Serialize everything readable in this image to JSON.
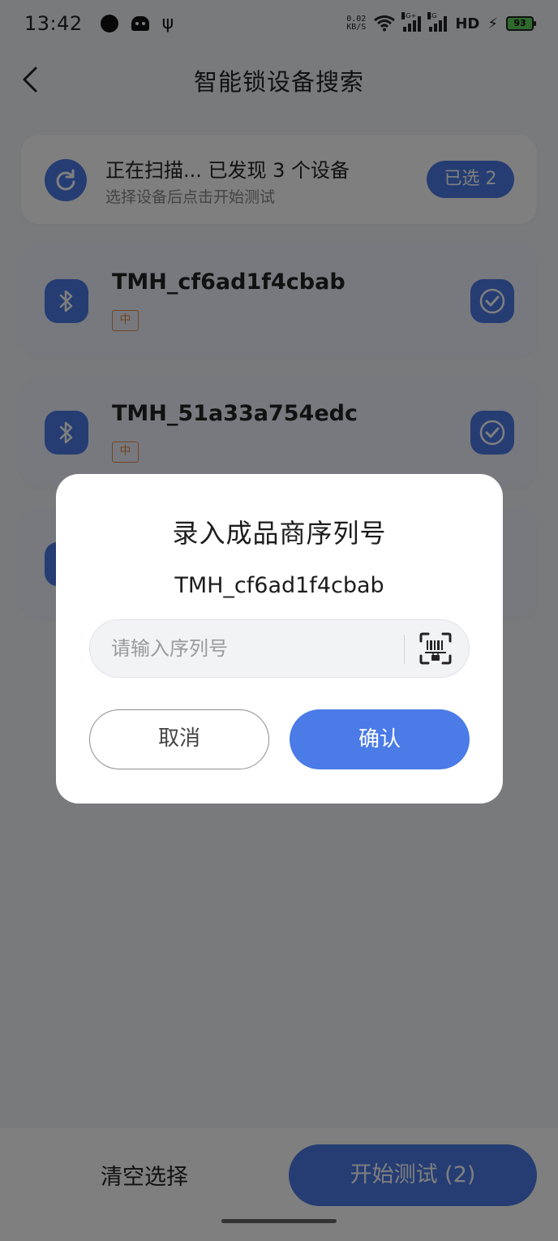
{
  "status_bar": {
    "time": "13:42",
    "net_speed_value": "0.02",
    "net_speed_unit": "KB/S",
    "signal_1_label": "4G+",
    "signal_2_label": "4G",
    "hd_label": "HD",
    "battery_level": "93"
  },
  "header": {
    "title": "智能锁设备搜索"
  },
  "scan_card": {
    "title": "正在扫描... 已发现 3 个设备",
    "subtitle": "选择设备后点击开始测试",
    "selected_badge": "已选 2"
  },
  "devices": [
    {
      "name": "TMH_cf6ad1f4cbab",
      "tag": "中",
      "checked": true
    },
    {
      "name": "TMH_51a33a754edc",
      "tag": "中",
      "checked": true
    }
  ],
  "bottom_bar": {
    "clear_label": "清空选择",
    "start_label": "开始测试 (2)"
  },
  "dialog": {
    "title": "录入成品商序列号",
    "device_name": "TMH_cf6ad1f4cbab",
    "serial_placeholder": "请输入序列号",
    "cancel_label": "取消",
    "confirm_label": "确认"
  },
  "colors": {
    "accent": "#4a7be6",
    "tag": "#e58a4a",
    "overlay": "rgba(0,0,0,0.5)"
  }
}
